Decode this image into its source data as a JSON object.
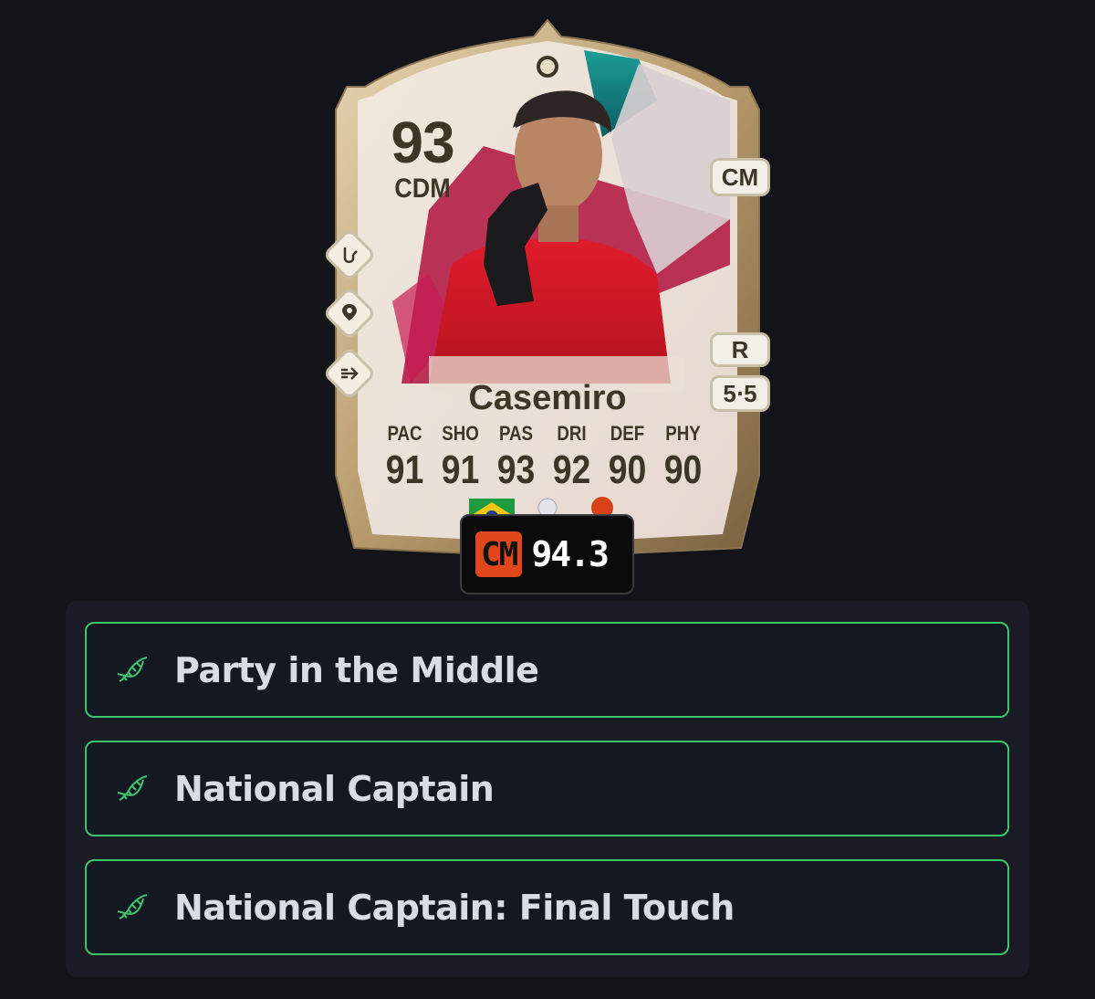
{
  "card": {
    "rating": "93",
    "position": "CDM",
    "name": "Casemiro",
    "alt_position": "CM",
    "preferred_foot": "R",
    "skills_weakfoot": "5⋅5",
    "stats": [
      {
        "label": "PAC",
        "value": "91"
      },
      {
        "label": "SHO",
        "value": "91"
      },
      {
        "label": "PAS",
        "value": "93"
      },
      {
        "label": "DRI",
        "value": "92"
      },
      {
        "label": "DEF",
        "value": "90"
      },
      {
        "label": "PHY",
        "value": "90"
      }
    ],
    "nation_icon": "brazil-flag-icon",
    "league_icon": "premier-league-icon",
    "club_icon": "manchester-united-crest-icon"
  },
  "rating_pill": {
    "position": "CM",
    "value": "94.3"
  },
  "playstyles": [
    {
      "label": "Party in the Middle",
      "icon": "dna-icon"
    },
    {
      "label": "National Captain",
      "icon": "dna-icon"
    },
    {
      "label": "National Captain: Final Touch",
      "icon": "dna-icon"
    }
  ],
  "colors": {
    "background": "#12141a",
    "panel": "#191c24",
    "accent_green": "#3ec46d",
    "pill_orange": "#e0481b",
    "card_text": "#3d3526"
  }
}
